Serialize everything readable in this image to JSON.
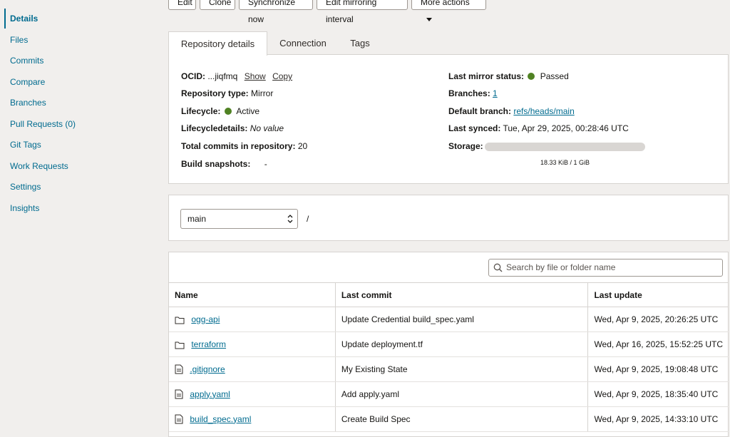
{
  "sidebar": {
    "items": [
      {
        "label": "Details",
        "active": true
      },
      {
        "label": "Files"
      },
      {
        "label": "Commits"
      },
      {
        "label": "Compare"
      },
      {
        "label": "Branches"
      },
      {
        "label": "Pull Requests (0)"
      },
      {
        "label": "Git Tags"
      },
      {
        "label": "Work Requests"
      },
      {
        "label": "Settings"
      },
      {
        "label": "Insights"
      }
    ]
  },
  "toolbar": {
    "edit": "Edit",
    "clone": "Clone",
    "sync": "Synchronize now",
    "edit_mirroring": "Edit mirroring interval",
    "more_actions": "More actions"
  },
  "tabs": [
    "Repository details",
    "Connection",
    "Tags"
  ],
  "details": {
    "ocid_label": "OCID:",
    "ocid_value": "...jiqfmq",
    "ocid_show": "Show",
    "ocid_copy": "Copy",
    "repo_type_label": "Repository type:",
    "repo_type_value": "Mirror",
    "lifecycle_label": "Lifecycle:",
    "lifecycle_value": "Active",
    "lifecycle_details_label": "Lifecycledetails:",
    "lifecycle_details_value": "No value",
    "total_commits_label": "Total commits in repository:",
    "total_commits_value": "20",
    "build_snapshots_label": "Build snapshots:",
    "build_snapshots_value": "-",
    "mirror_status_label": "Last mirror status:",
    "mirror_status_value": "Passed",
    "branches_label": "Branches:",
    "branches_value": "1",
    "default_branch_label": "Default branch:",
    "default_branch_value": "refs/heads/main",
    "last_synced_label": "Last synced:",
    "last_synced_value": "Tue, Apr 29, 2025, 00:28:46 UTC",
    "storage_label": "Storage:",
    "storage_text": "18.33 KiB / 1 GiB",
    "storage_fraction": 2e-05
  },
  "branch_selector": {
    "value": "main",
    "path": "/"
  },
  "search": {
    "placeholder": "Search by file or folder name"
  },
  "files": {
    "headers": [
      "Name",
      "Last commit",
      "Last update"
    ],
    "rows": [
      {
        "name": "ogg-api",
        "type": "folder",
        "commit": "Update Credential build_spec.yaml",
        "updated": "Wed, Apr 9, 2025, 20:26:25 UTC"
      },
      {
        "name": "terraform",
        "type": "folder",
        "commit": "Update deployment.tf",
        "updated": "Wed, Apr 16, 2025, 15:52:25 UTC"
      },
      {
        "name": ".gitignore",
        "type": "file",
        "commit": "My Existing State",
        "updated": "Wed, Apr 9, 2025, 19:08:48 UTC"
      },
      {
        "name": "apply.yaml",
        "type": "file",
        "commit": "Add apply.yaml",
        "updated": "Wed, Apr 9, 2025, 18:35:40 UTC"
      },
      {
        "name": "build_spec.yaml",
        "type": "file",
        "commit": "Create Build Spec",
        "updated": "Wed, Apr 9, 2025, 14:33:10 UTC"
      }
    ]
  },
  "colors": {
    "accent": "#006b8f",
    "status_green": "#508223"
  }
}
